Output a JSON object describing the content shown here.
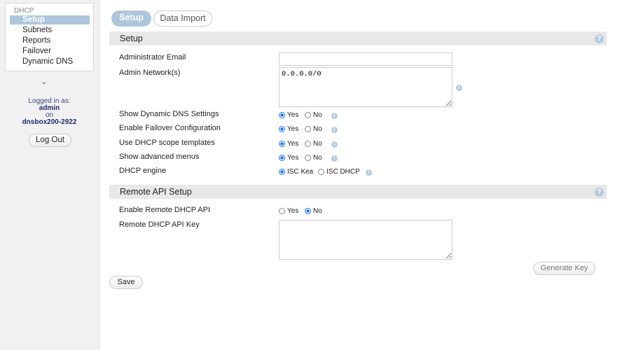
{
  "sidebar": {
    "title": "DHCP",
    "items": [
      {
        "label": "Setup"
      },
      {
        "label": "Subnets"
      },
      {
        "label": "Reports"
      },
      {
        "label": "Failover"
      },
      {
        "label": "Dynamic DNS"
      }
    ],
    "logged_in_as": "Logged in as:",
    "user": "admin",
    "on": "on",
    "host": "dnsbox200-2922",
    "logout": "Log Out"
  },
  "tabs": [
    {
      "label": "Setup"
    },
    {
      "label": "Data Import"
    }
  ],
  "setup": {
    "title": "Setup",
    "admin_email_label": "Administrator Email",
    "admin_email_value": "",
    "admin_network_label": "Admin Network(s)",
    "admin_network_value": "0.0.0.0/0",
    "rows": [
      {
        "label": "Show Dynamic DNS Settings",
        "opt1": "Yes",
        "opt2": "No",
        "selected": "Yes"
      },
      {
        "label": "Enable Failover Configuration",
        "opt1": "Yes",
        "opt2": "No",
        "selected": "Yes"
      },
      {
        "label": "Use DHCP scope templates",
        "opt1": "Yes",
        "opt2": "No",
        "selected": "Yes"
      },
      {
        "label": "Show advanced menus",
        "opt1": "Yes",
        "opt2": "No",
        "selected": "Yes"
      },
      {
        "label": "DHCP engine",
        "opt1": "ISC Kea",
        "opt2": "ISC DHCP",
        "selected": "ISC Kea"
      }
    ]
  },
  "remote": {
    "title": "Remote API Setup",
    "enable_label": "Enable Remote DHCP API",
    "opt1": "Yes",
    "opt2": "No",
    "selected": "No",
    "key_label": "Remote DHCP API Key",
    "key_value": "",
    "generate": "Generate Key"
  },
  "save": "Save",
  "help": "?",
  "info": "i"
}
